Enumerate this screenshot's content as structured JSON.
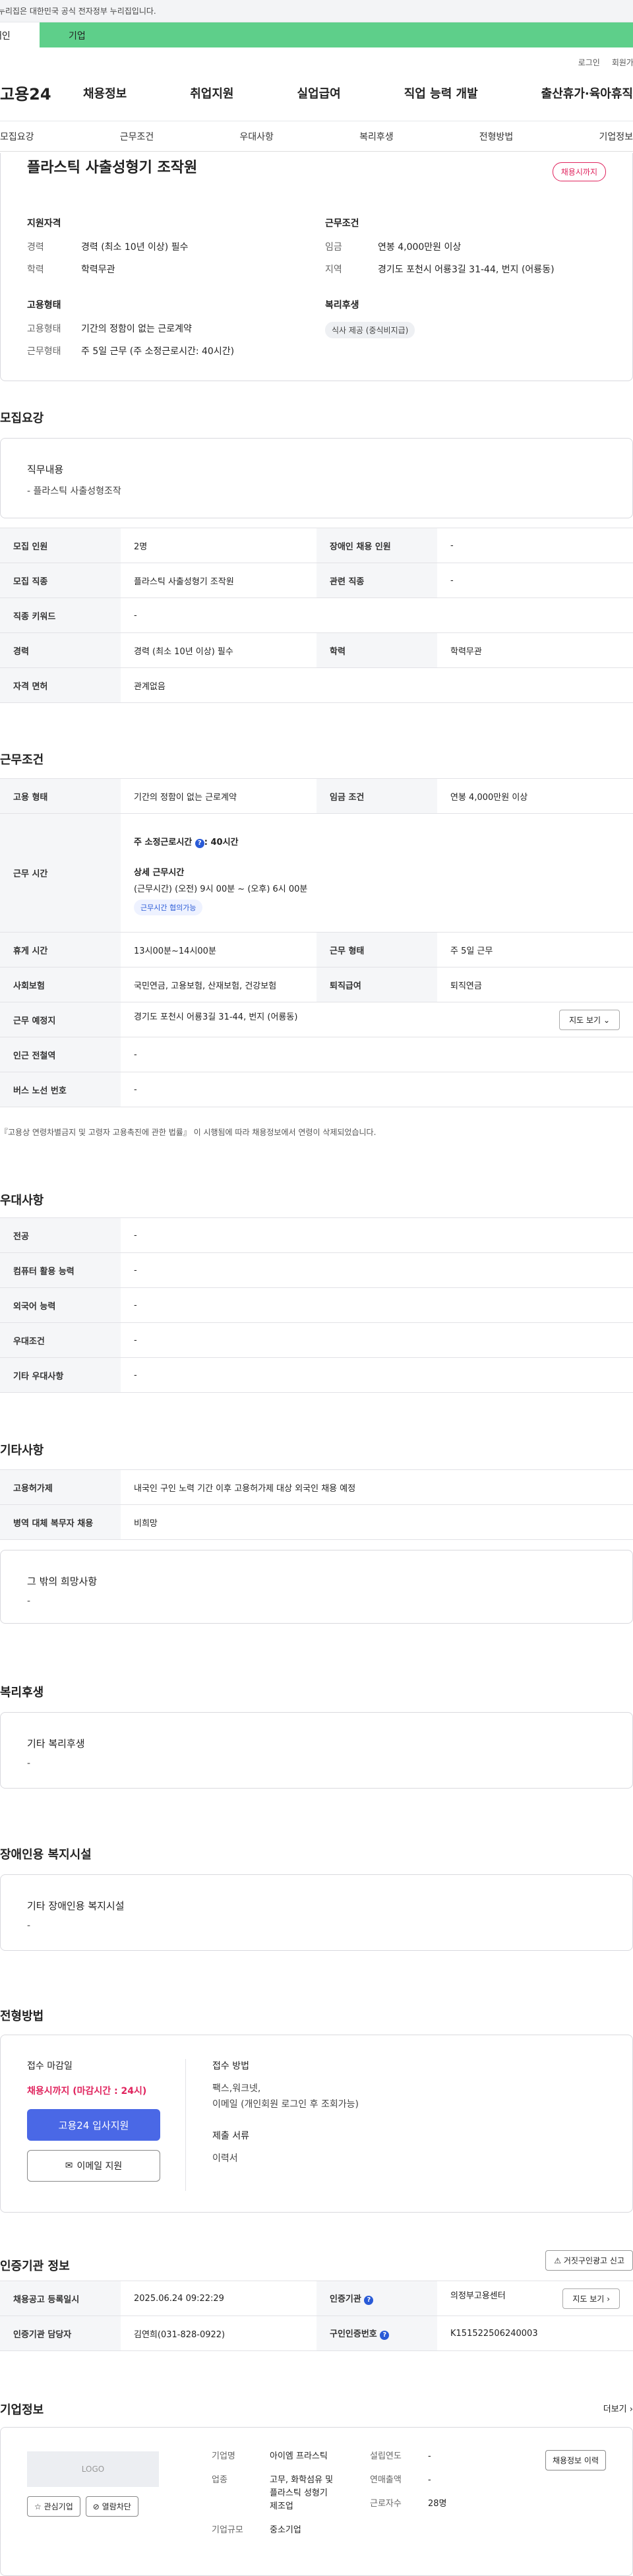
{
  "banner": "이 누리집은 대한민국 공식 전자정부 누리집입니다.",
  "toptabs": {
    "personal": "개인",
    "company": "기업"
  },
  "util": {
    "login": "로그인",
    "join": "회원가입"
  },
  "gnb": {
    "logo": "고용24",
    "menu": [
      "채용정보",
      "취업지원",
      "실업급여",
      "직업 능력 개발",
      "출산휴가·육아휴직"
    ]
  },
  "subnav": [
    "모집요강",
    "근무조건",
    "우대사항",
    "복리후생",
    "전형방법",
    "기업정보"
  ],
  "summary": {
    "title": "플라스틱 사출성형기 조작원",
    "badge": "채용시까지",
    "qual_h": "지원자격",
    "exp_k": "경력",
    "exp_v": "경력 (최소 10년 이상) 필수",
    "edu_k": "학력",
    "edu_v": "학력무관",
    "cond_h": "근무조건",
    "wage_k": "임금",
    "wage_v": "연봉 4,000만원 이상",
    "area_k": "지역",
    "area_v": "경기도 포천시 어룡3길 31-44, 번지 (어룡동)",
    "emp_h": "고용형태",
    "emptype_k": "고용형태",
    "emptype_v": "기간의 정함이 없는 근로계약",
    "worktype_k": "근무형태",
    "worktype_v": "주 5일 근무 (주 소정근로시간: 40시간)",
    "welfare_h": "복리후생",
    "welfare_chip": "식사 제공 (중식비지급)"
  },
  "recruit": {
    "title": "모집요강",
    "duty_h": "직무내용",
    "duty_v": "- 플라스틱 사출성형조작",
    "headcount_k": "모집 인원",
    "headcount_v": "2명",
    "disabled_k": "장애인 채용 인원",
    "disabled_v": "-",
    "job_k": "모집 직종",
    "job_v": "플라스틱 사출성형기 조작원",
    "related_k": "관련 직종",
    "related_v": "-",
    "keyword_k": "직종 키워드",
    "keyword_v": "-",
    "career_k": "경력",
    "career_v": "경력 (최소 10년 이상) 필수",
    "edu_k": "학력",
    "edu_v": "학력무관",
    "license_k": "자격 면허",
    "license_v": "관계없음"
  },
  "conditions": {
    "title": "근무조건",
    "emptype_k": "고용 형태",
    "emptype_v": "기간의 정함이 없는 근로계약",
    "wage_k": "임금 조건",
    "wage_v": "연봉 4,000만원 이상",
    "hours_k": "근무 시간",
    "hours_std": "주 소정근로시간",
    "hours_std_v": ": 40시간",
    "hours_detail_h": "상세 근무시간",
    "hours_detail_v": "(근무시간) (오전) 9시 00분 ~ (오후) 6시 00분",
    "hours_chip": "근무시간 협의가능",
    "break_k": "휴게 시간",
    "break_v": "13시00분~14시00분",
    "form_k": "근무 형태",
    "form_v": "주 5일 근무",
    "insurance_k": "사회보험",
    "insurance_v": "국민연금, 고용보험, 산재보험, 건강보험",
    "retire_k": "퇴직급여",
    "retire_v": "퇴직연금",
    "place_k": "근무 예정지",
    "place_v": "경기도 포천시 어룡3길 31-44, 번지 (어룡동)",
    "map_btn": "지도 보기",
    "station_k": "인근 전철역",
    "station_v": "-",
    "bus_k": "버스 노선 번호",
    "bus_v": "-",
    "note": "『고용상 연령차별금지 및 고령자 고용촉진에 관한 법률』 이 시행됨에 따라 채용정보에서 연령이 삭제되었습니다."
  },
  "prefer": {
    "title": "우대사항",
    "rows": [
      {
        "k": "전공",
        "v": "-"
      },
      {
        "k": "컴퓨터 활용 능력",
        "v": "-"
      },
      {
        "k": "외국어 능력",
        "v": "-"
      },
      {
        "k": "우대조건",
        "v": "-"
      },
      {
        "k": "기타 우대사항",
        "v": "-"
      }
    ]
  },
  "etc": {
    "title": "기타사항",
    "foreign_k": "고용허가제",
    "foreign_v": "내국인 구인 노력 기간 이후 고용허가제 대상 외국인 채용 예정",
    "military_k": "병역 대체 복무자 채용",
    "military_v": "비희망",
    "other_h": "그 밖의 희망사항",
    "other_v": "-"
  },
  "welfare": {
    "title": "복리후생",
    "h": "기타 복리후생",
    "v": "-"
  },
  "disabled": {
    "title": "장애인용 복지시설",
    "h": "기타 장애인용 복지시설",
    "v": "-"
  },
  "apply": {
    "title": "전형방법",
    "deadline_h": "접수 마감일",
    "deadline_v": "채용시까지 (마감시간 : 24시)",
    "primary_btn": "고용24 입사지원",
    "email_btn": "이메일 지원",
    "method_h": "접수 방법",
    "method_v1": "팩스,워크넷,",
    "method_v2": "이메일 (개인회원 로그인 후 조회가능)",
    "docs_h": "제출 서류",
    "docs_v": "이력서"
  },
  "agency": {
    "title": "인증기관 정보",
    "report_btn": "거짓구인광고 신고",
    "reg_k": "채용공고 등록일시",
    "reg_v": "2025.06.24 09:22:29",
    "inst_k": "인증기관",
    "inst_v": "의정부고용센터",
    "map_btn": "지도 보기",
    "mgr_k": "인증기관 담당자",
    "mgr_v": "김연희(031-828-0922)",
    "num_k": "구인인증번호",
    "num_v": "K151522506240003"
  },
  "company": {
    "title": "기업정보",
    "more": "더보기",
    "logo": "LOGO",
    "fav_btn": "관심기업",
    "block_btn": "열람차단",
    "name_k": "기업명",
    "name_v": "아이엠 프라스틱",
    "ind_k": "업종",
    "ind_v1": "고무, 화학섬유 및",
    "ind_v2": "플라스틱 성형기",
    "ind_v3": "제조업",
    "scale_k": "기업규모",
    "scale_v": "중소기업",
    "year_k": "설립연도",
    "year_v": "-",
    "sales_k": "연매출액",
    "sales_v": "-",
    "staff_k": "근로자수",
    "staff_v": "28명",
    "jobinfo_btn": "채용정보 이력"
  }
}
